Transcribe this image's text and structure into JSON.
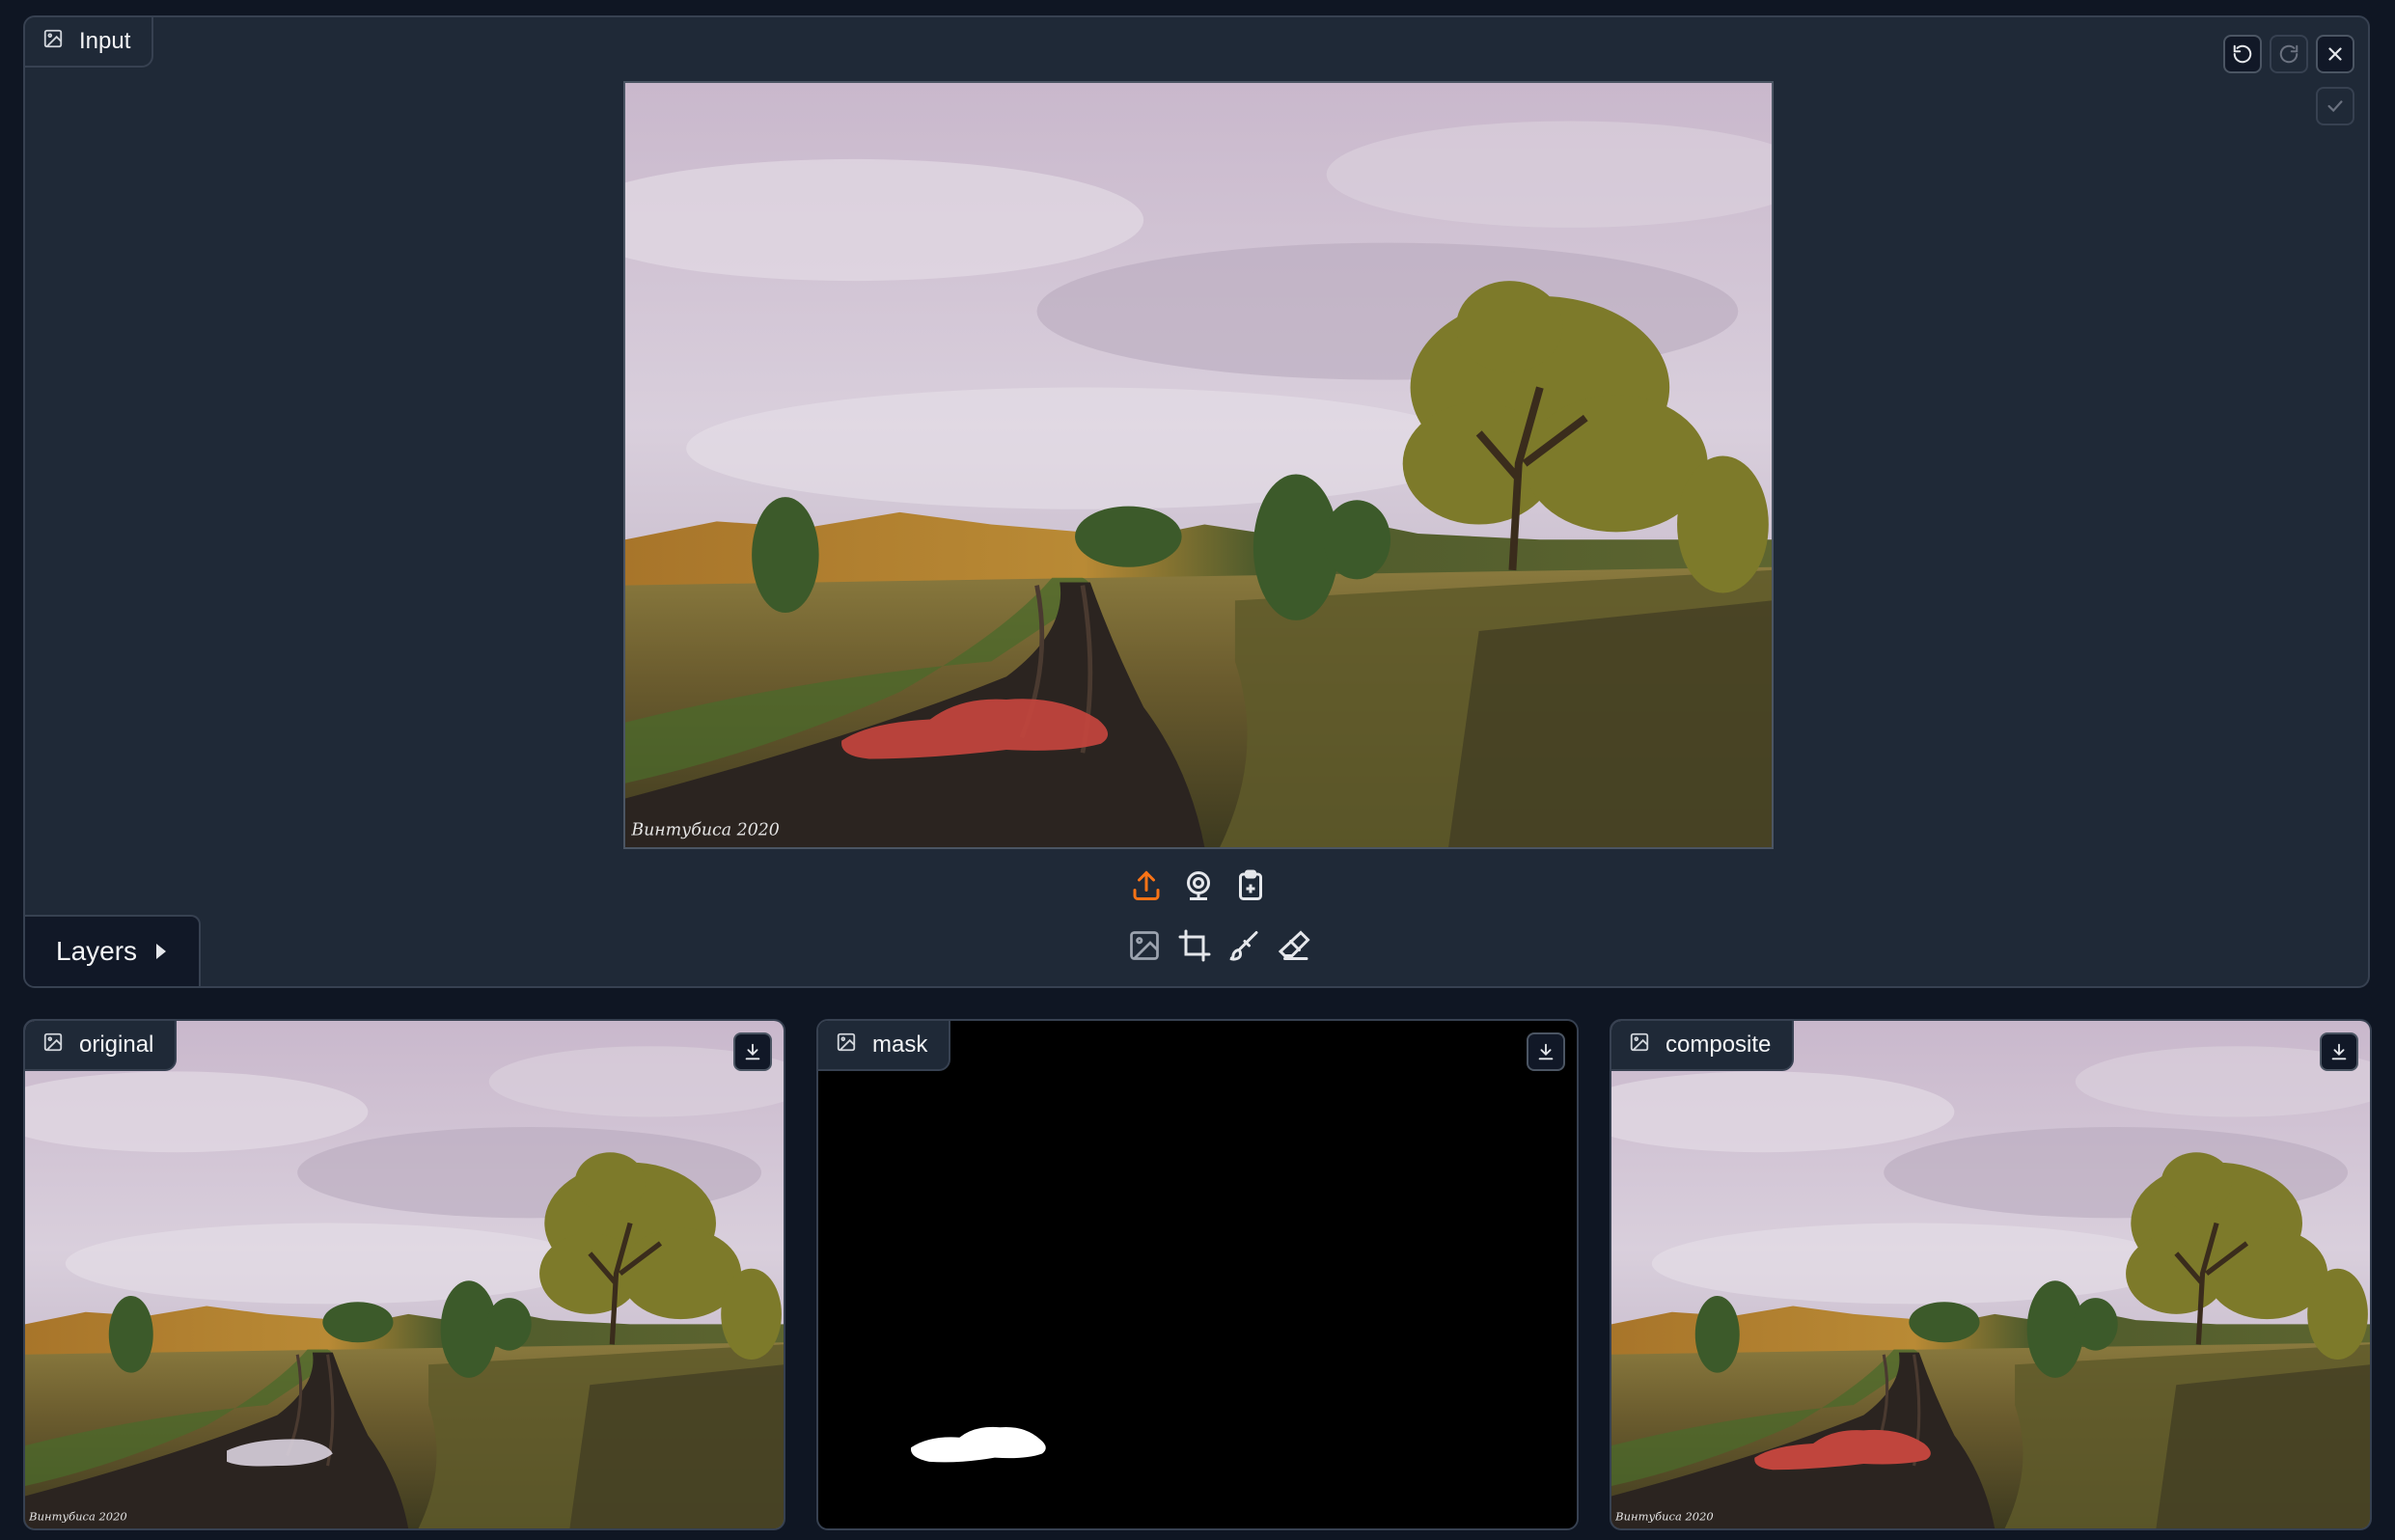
{
  "editor": {
    "label": "Input",
    "layers_label": "Layers",
    "icons": [
      "image-icon",
      "undo-icon",
      "redo-icon",
      "close-icon",
      "check-icon",
      "upload-icon",
      "webcam-icon",
      "clipboard-icon",
      "crop-icon",
      "brush-icon",
      "eraser-icon",
      "caret-right-icon"
    ],
    "accent_color": "#f97316",
    "brush_color": "#c0453d"
  },
  "outputs": [
    {
      "label": "original"
    },
    {
      "label": "mask"
    },
    {
      "label": "composite"
    }
  ],
  "watermark": "Винтубиса 2020"
}
